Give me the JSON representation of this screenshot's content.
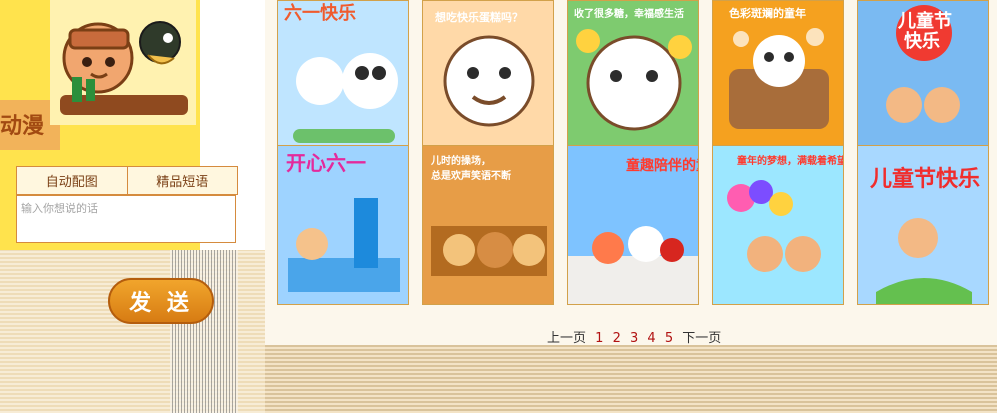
{
  "left": {
    "side_text": "动漫",
    "tabs": [
      {
        "label": "自动配图"
      },
      {
        "label": "精品短语"
      }
    ],
    "input_placeholder": "输入你想说的话",
    "send_label": "发 送"
  },
  "grid": {
    "cards": [
      {
        "title": "六一快乐",
        "bg": "#bfe5ff",
        "accent": "#f05b2d"
      },
      {
        "title": "想吃快乐蛋糕吗？",
        "bg": "#ffd9a8",
        "accent": "#ffffff"
      },
      {
        "title": "收了很多糖，幸福感生活",
        "bg": "#7ecb6f",
        "accent": "#ffffff"
      },
      {
        "title": "色彩斑斓的童年",
        "bg": "#f5a11f",
        "accent": "#fff"
      },
      {
        "title": "儿童节快乐",
        "bg": "#7abaf2",
        "accent": "#e01f1f"
      },
      {
        "title": "开心六一",
        "bg": "#9ed3ff",
        "accent": "#e42a9c"
      },
      {
        "title": "儿时的操场，总是欢声笑语不断",
        "bg": "#e79d47",
        "accent": "#ffffff"
      },
      {
        "title": "童趣陪伴的童年",
        "bg": "#7ec3ff",
        "accent": "#ff3b2f"
      },
      {
        "title": "童年的梦想，满载着希望",
        "bg": "#9ce7ff",
        "accent": "#ff3b2f"
      },
      {
        "title": "儿童节快乐",
        "bg": "#a8d8ff",
        "accent": "#f02d2d"
      }
    ]
  },
  "pager": {
    "prev": "上一页",
    "pages": [
      "1",
      "2",
      "3",
      "4",
      "5"
    ],
    "next": "下一页"
  }
}
